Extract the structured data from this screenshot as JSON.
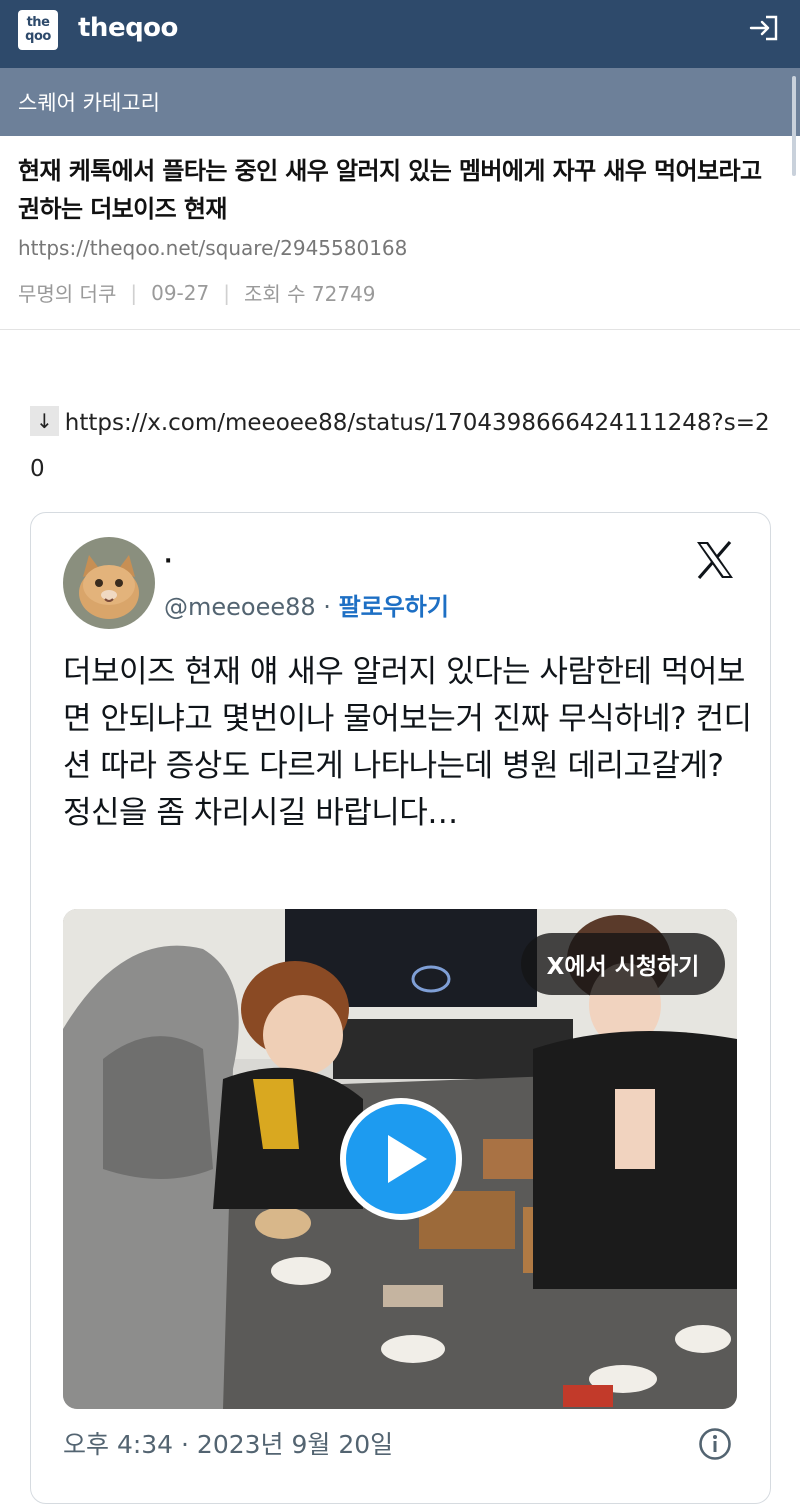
{
  "header": {
    "logo_top": "the",
    "logo_bottom": "qoo",
    "site_name": "theqoo",
    "login_icon": "login-arrow-icon"
  },
  "category": {
    "label": "스퀘어 카테고리"
  },
  "post": {
    "title": "현재 케톡에서 플타는 중인 새우 알러지 있는 멤버에게 자꾸 새우 먹어보라고 권하는 더보이즈 현재",
    "url": "https://theqoo.net/square/2945580168",
    "author": "무명의 더쿠",
    "date": "09-27",
    "views": "조회 수 72749"
  },
  "link": {
    "arrow": "↓",
    "text": "https://x.com/meeoee88/status/1704398666424111248?s=20"
  },
  "tweet": {
    "display_name": "·",
    "handle": "@meeoee88",
    "dot": " · ",
    "follow": "팔로우하기",
    "brand_icon": "x-logo-icon",
    "text": "더보이즈 현재 얘 새우 알러지 있다는 사람한테 먹어보면 안되냐고 몇번이나 물어보는거 진짜 무식하네? 컨디션 따라 증상도 다르게 나타나는데 병원 데리고갈게? 정신을 좀 차리시길 바랍니다…",
    "watch_label": "X에서 시청하기",
    "timestamp": "오후 4:34 · 2023년 9월 20일",
    "play_icon": "play-icon",
    "info_icon": "info-icon"
  },
  "colors": {
    "topbar": "#2e4a6b",
    "category_bar": "#6d8099",
    "follow_link": "#1d6fc4",
    "play_button": "#1d9bf0"
  }
}
